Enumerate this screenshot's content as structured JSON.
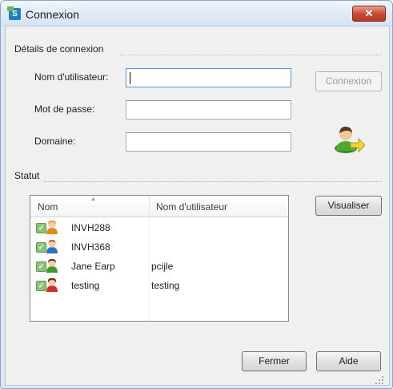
{
  "window": {
    "title": "Connexion",
    "close_glyph": "✕",
    "app_icon": "app-logo-icon"
  },
  "login_section": {
    "heading": "Détails de connexion",
    "username": {
      "label": "Nom d'utilisateur:",
      "value": "",
      "placeholder": ""
    },
    "password": {
      "label": "Mot de passe:",
      "value": "",
      "placeholder": ""
    },
    "domain": {
      "label": "Domaine:",
      "value": "",
      "placeholder": ""
    },
    "connect_button": "Connexion",
    "connect_enabled": false,
    "user_icon": "user-login-arrow-icon"
  },
  "status_section": {
    "heading": "Statut",
    "view_button": "Visualiser",
    "columns": [
      "Nom",
      "Nom d'utilisateur"
    ],
    "sorted_column": "Nom",
    "rows": [
      {
        "name": "INVH288",
        "username": "",
        "avatar": "orange-user-icon",
        "checked": true
      },
      {
        "name": "INVH368",
        "username": "",
        "avatar": "blue-user-icon",
        "checked": true
      },
      {
        "name": "Jane Earp",
        "username": "pcijle",
        "avatar": "green-user-icon",
        "checked": true
      },
      {
        "name": "testing",
        "username": "testing",
        "avatar": "red-user-icon",
        "checked": true
      }
    ]
  },
  "footer": {
    "close_button": "Fermer",
    "help_button": "Aide"
  },
  "colors": {
    "titlebar_top": "#eef4fb",
    "close_red": "#c8462f",
    "client_bg": "#f0f0f0",
    "input_focus": "#5d93cf"
  }
}
